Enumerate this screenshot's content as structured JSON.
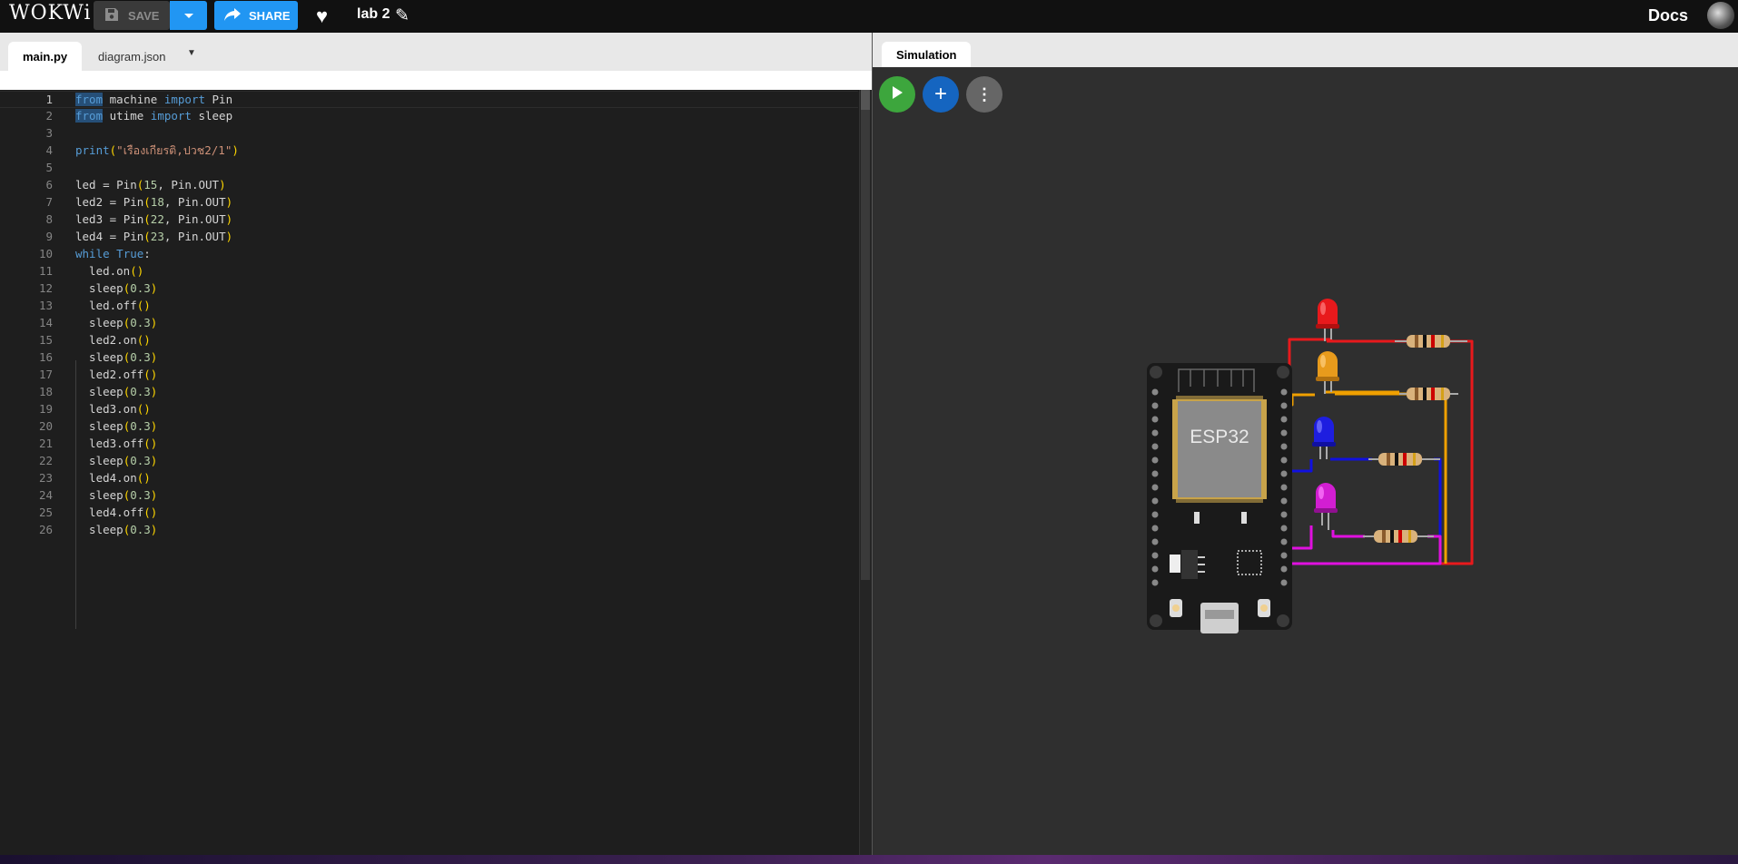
{
  "app": {
    "logo": "WOKWi",
    "project_name": "lab 2",
    "docs_label": "Docs"
  },
  "toolbar": {
    "save_label": "SAVE",
    "share_label": "SHARE"
  },
  "editor": {
    "tabs": [
      {
        "label": "main.py"
      },
      {
        "label": "diagram.json"
      }
    ],
    "lines": [
      {
        "num": "1"
      },
      {
        "num": "2"
      },
      {
        "num": "3"
      },
      {
        "num": "4"
      },
      {
        "num": "5"
      },
      {
        "num": "6"
      },
      {
        "num": "7"
      },
      {
        "num": "8"
      },
      {
        "num": "9"
      },
      {
        "num": "10"
      },
      {
        "num": "11"
      },
      {
        "num": "12"
      },
      {
        "num": "13"
      },
      {
        "num": "14"
      },
      {
        "num": "15"
      },
      {
        "num": "16"
      },
      {
        "num": "17"
      },
      {
        "num": "18"
      },
      {
        "num": "19"
      },
      {
        "num": "20"
      },
      {
        "num": "21"
      },
      {
        "num": "22"
      },
      {
        "num": "23"
      },
      {
        "num": "24"
      },
      {
        "num": "25"
      },
      {
        "num": "26"
      }
    ],
    "code": {
      "l1": [
        "from",
        " machine ",
        "import",
        " Pin"
      ],
      "l2": [
        "from",
        " utime ",
        "import",
        " sleep"
      ],
      "l4": [
        "print",
        "(",
        "\"เรืองเกียรติ,ปวช2/1\"",
        ")"
      ],
      "l6": [
        "led = ",
        "Pin",
        "(",
        "15",
        ", Pin.OUT",
        ")"
      ],
      "l7": [
        "led2 = ",
        "Pin",
        "(",
        "18",
        ", Pin.OUT",
        ")"
      ],
      "l8": [
        "led3 = ",
        "Pin",
        "(",
        "22",
        ", Pin.OUT",
        ")"
      ],
      "l9": [
        "led4 = ",
        "Pin",
        "(",
        "23",
        ", Pin.OUT",
        ")"
      ],
      "l10": [
        "while",
        " ",
        "True",
        ":"
      ],
      "l11": [
        "  led.on",
        "()"
      ],
      "l12": [
        "  sleep",
        "(",
        "0.3",
        ")"
      ],
      "l13": [
        "  led.off",
        "()"
      ],
      "l14": [
        "  sleep",
        "(",
        "0.3",
        ")"
      ],
      "l15": [
        "  led2.on",
        "()"
      ],
      "l16": [
        "  sleep",
        "(",
        "0.3",
        ")"
      ],
      "l17": [
        "  led2.off",
        "()"
      ],
      "l18": [
        "  sleep",
        "(",
        "0.3",
        ")"
      ],
      "l19": [
        "  led3.on",
        "()"
      ],
      "l20": [
        "  sleep",
        "(",
        "0.3",
        ")"
      ],
      "l21": [
        "  led3.off",
        "()"
      ],
      "l22": [
        "  sleep",
        "(",
        "0.3",
        ")"
      ],
      "l23": [
        "  led4.on",
        "()"
      ],
      "l24": [
        "  sleep",
        "(",
        "0.3",
        ")"
      ],
      "l25": [
        "  led4.off",
        "()"
      ],
      "l26": [
        "  sleep",
        "(",
        "0.3",
        ")"
      ]
    }
  },
  "simulation": {
    "tab_label": "Simulation",
    "board_label": "ESP32",
    "led_colors": [
      "#e8191c",
      "#e89b1c",
      "#1e1ee0",
      "#d21ed2"
    ],
    "wire_colors": [
      "#e8191c",
      "#f0a000",
      "#1010e0",
      "#e010e0"
    ]
  },
  "colors": {
    "accent": "#2196f3",
    "play": "#3da63d",
    "add": "#1565c0"
  },
  "icons": [
    "save-icon",
    "chevron-down-icon",
    "share-icon",
    "heart-icon",
    "pencil-icon",
    "play-icon",
    "plus-icon",
    "more-vert-icon"
  ]
}
